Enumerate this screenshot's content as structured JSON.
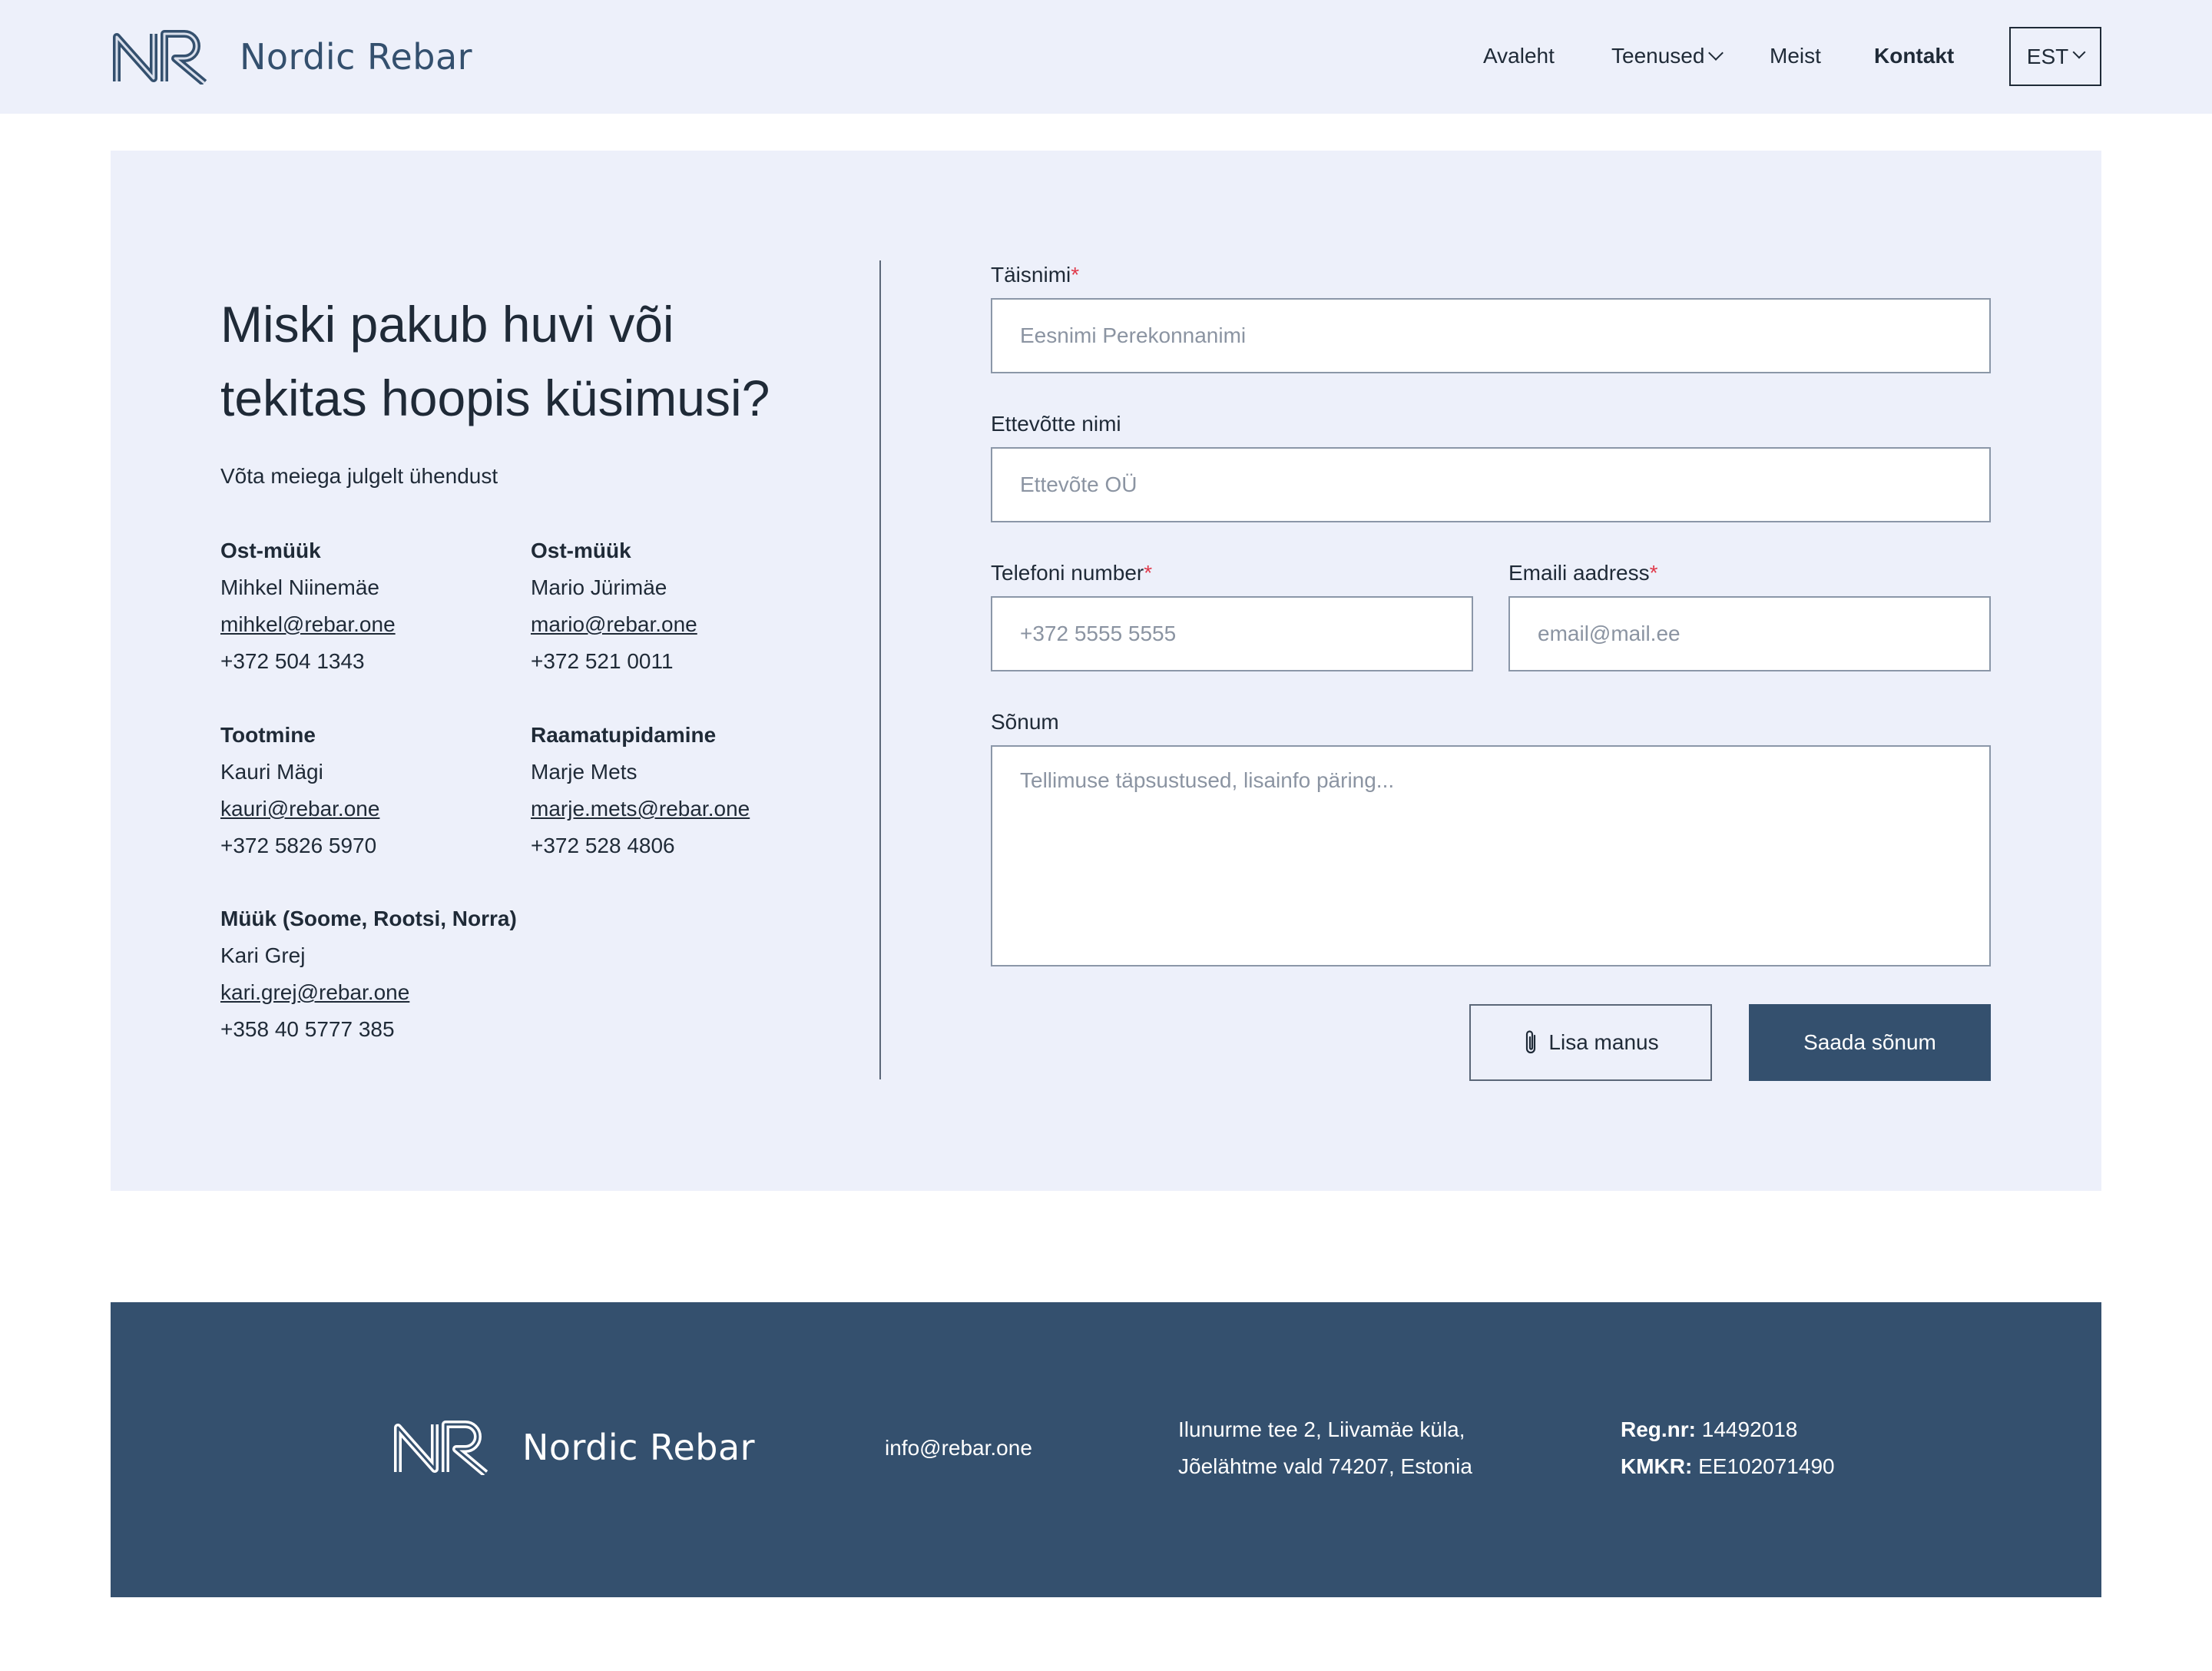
{
  "header": {
    "brand": "Nordic Rebar",
    "nav": [
      {
        "label": "Avaleht"
      },
      {
        "label": "Teenused"
      },
      {
        "label": "Meist"
      },
      {
        "label": "Kontakt"
      }
    ],
    "language": "EST"
  },
  "intro": {
    "headline_line1": "Miski pakub huvi või",
    "headline_line2": "tekitas hoopis küsimusi?",
    "subline": "Võta meiega julgelt ühendust"
  },
  "contacts": [
    {
      "role": "Ost-müük",
      "name": "Mihkel Niinemäe",
      "email": "mihkel@rebar.one",
      "phone": "+372 504 1343"
    },
    {
      "role": "Ost-müük",
      "name": "Mario Jürimäe",
      "email": "mario@rebar.one",
      "phone": "+372 521 0011"
    },
    {
      "role": "Tootmine",
      "name": "Kauri Mägi",
      "email": "kauri@rebar.one",
      "phone": "+372 5826 5970"
    },
    {
      "role": "Raamatupidamine",
      "name": "Marje Mets",
      "email": "marje.mets@rebar.one",
      "phone": "+372 528 4806"
    },
    {
      "role": "Müük (Soome, Rootsi, Norra)",
      "name": "Kari Grej",
      "email": "kari.grej@rebar.one",
      "phone": "+358 40 5777 385"
    }
  ],
  "form": {
    "fullname": {
      "label": "Täisnimi",
      "required_mark": "*",
      "placeholder": "Eesnimi Perekonnanimi",
      "value": ""
    },
    "company": {
      "label": "Ettevõtte nimi",
      "placeholder": "Ettevõte OÜ",
      "value": ""
    },
    "phone": {
      "label": "Telefoni number",
      "required_mark": "*",
      "placeholder": "+372 5555 5555",
      "value": ""
    },
    "email": {
      "label": "Emaili aadress",
      "required_mark": "*",
      "placeholder": "email@mail.ee",
      "value": ""
    },
    "message": {
      "label": "Sõnum",
      "placeholder": "Tellimuse täpsustused, lisainfo päring...",
      "value": ""
    },
    "attach_label": "Lisa manus",
    "send_label": "Saada sõnum"
  },
  "footer": {
    "brand": "Nordic Rebar",
    "email": "info@rebar.one",
    "address_line1": "Ilunurme tee 2, Liivamäe küla,",
    "address_line2": "Jõelähtme vald 74207, Estonia",
    "reg_label": "Reg.nr:",
    "reg_value": "14492018",
    "kmkr_label": "KMKR:",
    "kmkr_value": "EE102071490"
  },
  "colors": {
    "header_bg": "#edf0fa",
    "panel_bg": "#edf0fa",
    "brand_navy": "#34506e",
    "text_dark": "#1f2a37",
    "required_red": "#e0394a"
  },
  "icons": {
    "logo": "nr-logo-icon",
    "dropdown": "chevron-down-icon",
    "attach": "paperclip-icon"
  }
}
